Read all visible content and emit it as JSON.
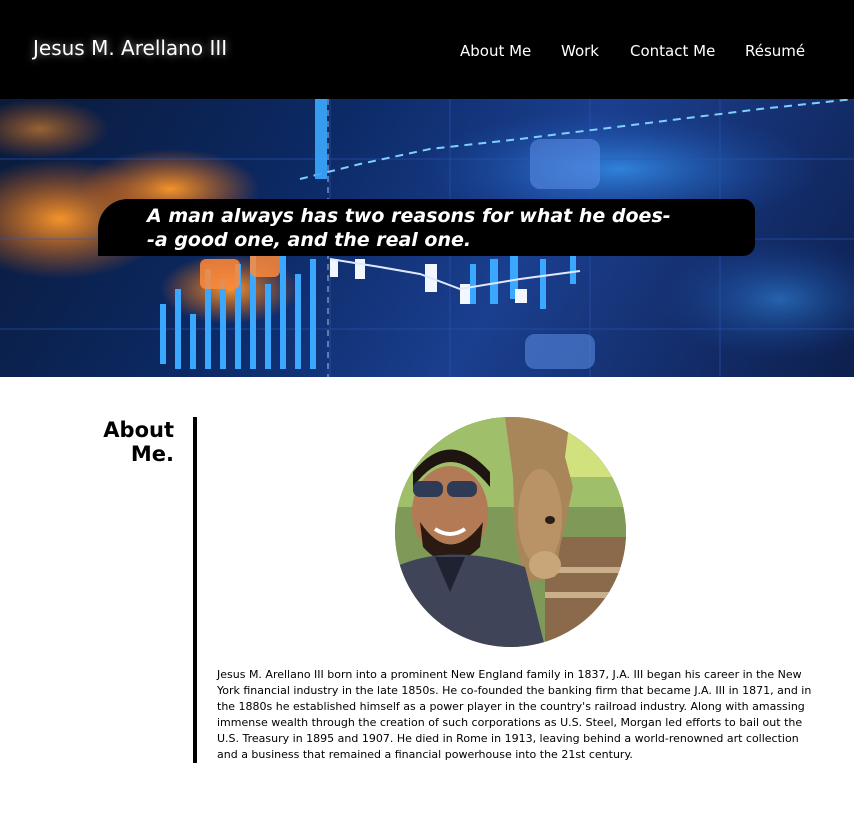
{
  "header": {
    "site_title": "Jesus M. Arellano III",
    "nav": [
      {
        "label": "About Me"
      },
      {
        "label": "Work"
      },
      {
        "label": "Contact Me"
      },
      {
        "label": "Résumé"
      }
    ]
  },
  "hero": {
    "quote_line1": "A man always has two reasons for what he does-",
    "quote_line2": "-a good one, and the real one."
  },
  "about": {
    "heading_line1": "About",
    "heading_line2": "Me.",
    "bio": "Jesus M. Arellano III born into a prominent New England family in 1837, J.A. III began his career in the New York financial industry in the late 1850s. He co-founded the banking firm that became J.A. III in 1871, and in the 1880s he established himself as a power player in the country's railroad industry. Along with amassing immense wealth through the creation of such corporations as U.S. Steel, Morgan led efforts to bail out the U.S. Treasury in 1895 and 1907. He died in Rome in 1913, leaving behind a world-renowned art collection and a business that remained a financial powerhouse into the 21st century."
  },
  "colors": {
    "header_bg": "#000000",
    "quote_bg": "#000000",
    "text_on_dark": "#ffffff"
  }
}
